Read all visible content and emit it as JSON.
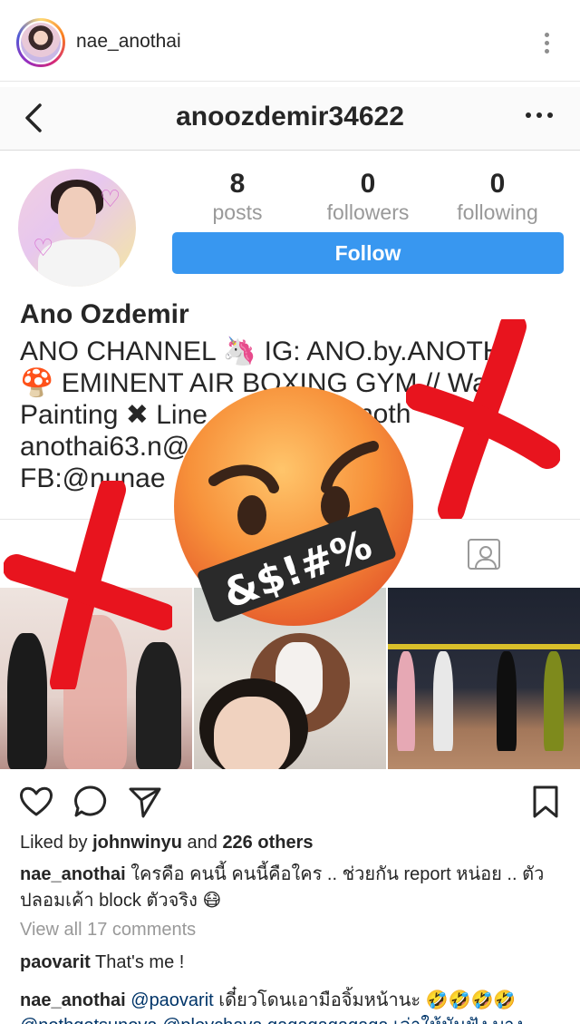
{
  "post": {
    "username": "nae_anothai"
  },
  "profile": {
    "title": "anoozdemir34622",
    "stats": [
      {
        "num": "8",
        "label": "posts"
      },
      {
        "num": "0",
        "label": "followers"
      },
      {
        "num": "0",
        "label": "following"
      }
    ],
    "follow_label": "Follow",
    "name": "Ano Ozdemir",
    "bio": [
      "ANO CHANNEL 🦄 IG: ANO.by.ANOTH",
      "🍄 EMINENT AIR BOXING GYM // Wa",
      "Painting ✖ Line",
      "anothai63.n@",
      "FB:@nunae"
    ],
    "bio_fragment": "noth"
  },
  "sticker": {
    "censor_text": "&$!#%"
  },
  "likes": {
    "prefix": "Liked by ",
    "user": "johnwinyu",
    "middle": " and ",
    "count": "226 others"
  },
  "caption": {
    "user": "nae_anothai",
    "text": " ใครคือ คนนี้ คนนี้คือใคร .. ช่วยกัน report หน่อย .. ตัวปลอมเค้า block ตัวจริง 😷"
  },
  "view_all": "View all 17 comments",
  "comments": [
    {
      "user": "paovarit",
      "text": " That's me !"
    },
    {
      "user": "nae_anothai",
      "mention": " @paovarit",
      "text": " เดี๋ยวโดนเอามือจิ้มหน้านะ 🤣🤣🤣🤣"
    },
    {
      "text": "@nothgetsunova @ploychaya gagagagagaga เล่าให้มันฟัง บาง"
    }
  ],
  "colors": {
    "follow_blue": "#3897f0",
    "cross_red": "#e8141e",
    "emoji_orange": "#f7913a"
  }
}
